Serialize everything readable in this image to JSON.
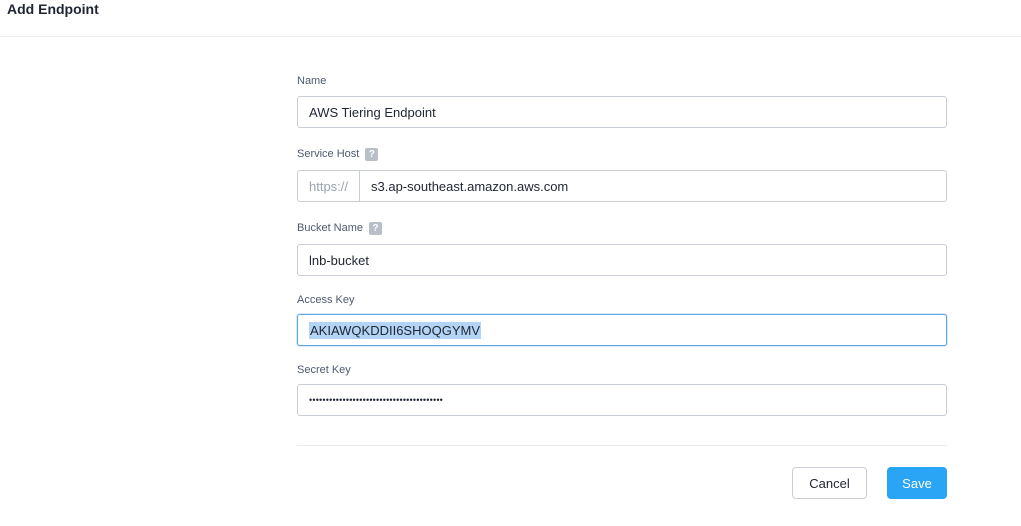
{
  "header": {
    "title": "Add Endpoint"
  },
  "form": {
    "name": {
      "label": "Name",
      "value": "AWS Tiering Endpoint"
    },
    "service_host": {
      "label": "Service Host",
      "help": "?",
      "prefix": "https://",
      "value": "s3.ap-southeast.amazon.aws.com"
    },
    "bucket_name": {
      "label": "Bucket Name",
      "help": "?",
      "value": "lnb-bucket"
    },
    "access_key": {
      "label": "Access Key",
      "value": "AKIAWQKDDII6SHOQGYMV"
    },
    "secret_key": {
      "label": "Secret Key",
      "value": "••••••••••••••••••••••••••••••••••••••••"
    }
  },
  "actions": {
    "cancel_label": "Cancel",
    "save_label": "Save"
  },
  "colors": {
    "primary": "#2aa4f4",
    "focus_border": "#5ea6e6",
    "selection": "#b3d4f5"
  }
}
